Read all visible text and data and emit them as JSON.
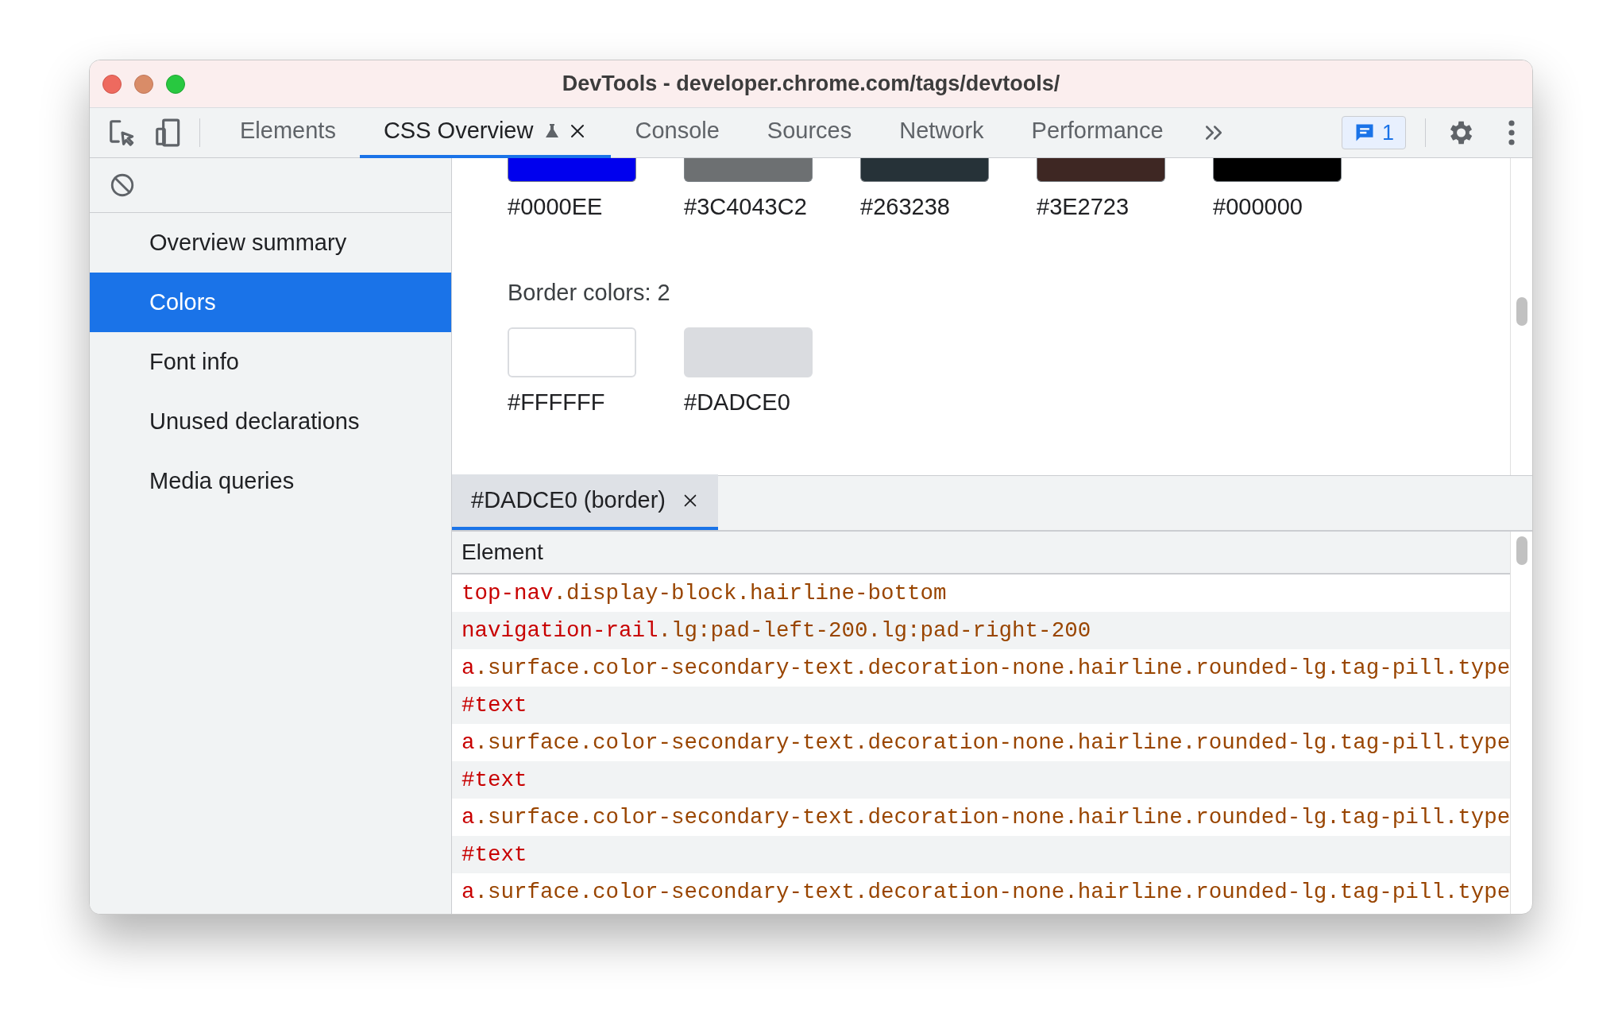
{
  "window": {
    "title": "DevTools - developer.chrome.com/tags/devtools/"
  },
  "tabs": [
    {
      "label": "Elements",
      "selected": false,
      "kind": "plain"
    },
    {
      "label": "CSS Overview",
      "selected": true,
      "kind": "experimental"
    },
    {
      "label": "Console",
      "selected": false,
      "kind": "plain"
    },
    {
      "label": "Sources",
      "selected": false,
      "kind": "plain"
    },
    {
      "label": "Network",
      "selected": false,
      "kind": "plain"
    },
    {
      "label": "Performance",
      "selected": false,
      "kind": "plain"
    }
  ],
  "issues_badge": "1",
  "sidebar": {
    "items": [
      {
        "label": "Overview summary",
        "selected": false
      },
      {
        "label": "Colors",
        "selected": true
      },
      {
        "label": "Font info",
        "selected": false
      },
      {
        "label": "Unused declarations",
        "selected": false
      },
      {
        "label": "Media queries",
        "selected": false
      }
    ]
  },
  "text_colors": [
    {
      "label": "#0000EE",
      "color": "#0000ee"
    },
    {
      "label": "#3C4043C2",
      "color": "#6d7072"
    },
    {
      "label": "#263238",
      "color": "#263238"
    },
    {
      "label": "#3E2723",
      "color": "#3e2723"
    },
    {
      "label": "#000000",
      "color": "#000000"
    }
  ],
  "border_colors": {
    "heading": "Border colors: 2",
    "swatches": [
      {
        "label": "#FFFFFF",
        "color": "#ffffff"
      },
      {
        "label": "#DADCE0",
        "color": "#dadce0"
      }
    ]
  },
  "detail_tab": {
    "label": "#DADCE0 (border)",
    "selected": true
  },
  "table": {
    "columns": [
      "Element"
    ],
    "rows": [
      {
        "tag": "top-nav",
        "classes": ".display-block.hairline-bottom"
      },
      {
        "tag": "navigation-rail",
        "classes": ".lg:pad-left-200.lg:pad-right-200"
      },
      {
        "tag": "a",
        "classes": ".surface.color-secondary-text.decoration-none.hairline.rounded-lg.tag-pill.type"
      },
      {
        "tag": "#text",
        "classes": ""
      },
      {
        "tag": "a",
        "classes": ".surface.color-secondary-text.decoration-none.hairline.rounded-lg.tag-pill.type"
      },
      {
        "tag": "#text",
        "classes": ""
      },
      {
        "tag": "a",
        "classes": ".surface.color-secondary-text.decoration-none.hairline.rounded-lg.tag-pill.type"
      },
      {
        "tag": "#text",
        "classes": ""
      },
      {
        "tag": "a",
        "classes": ".surface.color-secondary-text.decoration-none.hairline.rounded-lg.tag-pill.type"
      }
    ]
  }
}
